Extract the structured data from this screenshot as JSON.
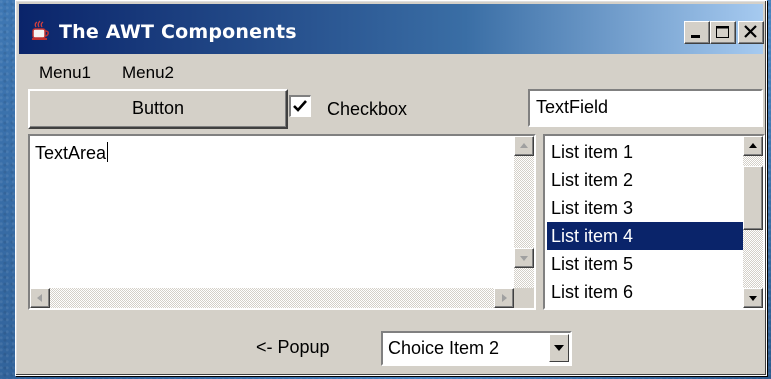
{
  "window": {
    "title": "The AWT Components",
    "icon": "java-cup-icon",
    "controls": [
      "minimize-icon",
      "maximize-icon",
      "close-icon"
    ]
  },
  "menubar": {
    "items": [
      {
        "label": "Menu1"
      },
      {
        "label": "Menu2"
      }
    ]
  },
  "button": {
    "label": "Button"
  },
  "checkbox": {
    "label": "Checkbox",
    "checked": true
  },
  "textfield": {
    "value": "TextField"
  },
  "textarea": {
    "value": "TextArea"
  },
  "list": {
    "items": [
      {
        "label": "List item 1"
      },
      {
        "label": "List item 2"
      },
      {
        "label": "List item 3"
      },
      {
        "label": "List item 4",
        "selected": true
      },
      {
        "label": "List item 5"
      },
      {
        "label": "List item 6"
      }
    ]
  },
  "popup": {
    "label": "<- Popup"
  },
  "choice": {
    "selected": "Choice Item 2"
  },
  "colors": {
    "titlebar_start": "#0a246a",
    "titlebar_end": "#a6caf0",
    "face": "#d4d0c8",
    "selection": "#0a246a"
  }
}
